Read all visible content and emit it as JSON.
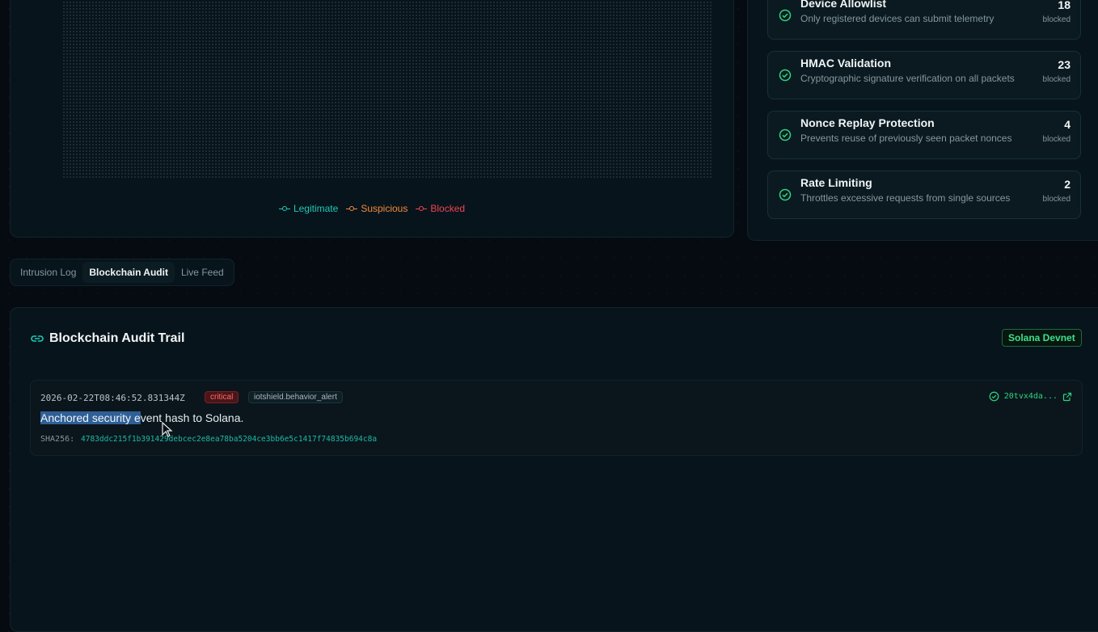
{
  "chart": {
    "legend": [
      {
        "label": "Legitimate",
        "color": "#1fc8b6"
      },
      {
        "label": "Suspicious",
        "color": "#f28a3c"
      },
      {
        "label": "Blocked",
        "color": "#ef4452"
      }
    ]
  },
  "rules": [
    {
      "title": "Device Allowlist",
      "description": "Only registered devices can submit telemetry",
      "count": "18",
      "unit": "blocked"
    },
    {
      "title": "HMAC Validation",
      "description": "Cryptographic signature verification on all packets",
      "count": "23",
      "unit": "blocked"
    },
    {
      "title": "Nonce Replay Protection",
      "description": "Prevents reuse of previously seen packet nonces",
      "count": "4",
      "unit": "blocked"
    },
    {
      "title": "Rate Limiting",
      "description": "Throttles excessive requests from single sources",
      "count": "2",
      "unit": "blocked"
    }
  ],
  "tabs": [
    {
      "label": "Intrusion Log",
      "active": false
    },
    {
      "label": "Blockchain Audit",
      "active": true
    },
    {
      "label": "Live Feed",
      "active": false
    }
  ],
  "audit": {
    "title": "Blockchain Audit Trail",
    "network_badge": "Solana Devnet",
    "entries": [
      {
        "timestamp": "2026-02-22T08:46:52.831344Z",
        "severity": "critical",
        "source": "iotshield.behavior_alert",
        "message_selected": "Anchored security e",
        "message_rest": "vent hash to Solana.",
        "hash_label": "SHA256:",
        "hash": "4783ddc215f1b391429debcec2e8ea78ba5204ce3bb6e5c1417f74835b694c8a",
        "tx": "20tvx4da..."
      }
    ]
  },
  "colors": {
    "accent": "#1fc8b6",
    "success": "#2fd47f",
    "critical": "#ff6b6b"
  },
  "icons": {
    "rule": "check-circle-icon",
    "audit_title": "link-icon",
    "tx_status": "check-circle-icon",
    "tx_link": "external-link-icon"
  }
}
